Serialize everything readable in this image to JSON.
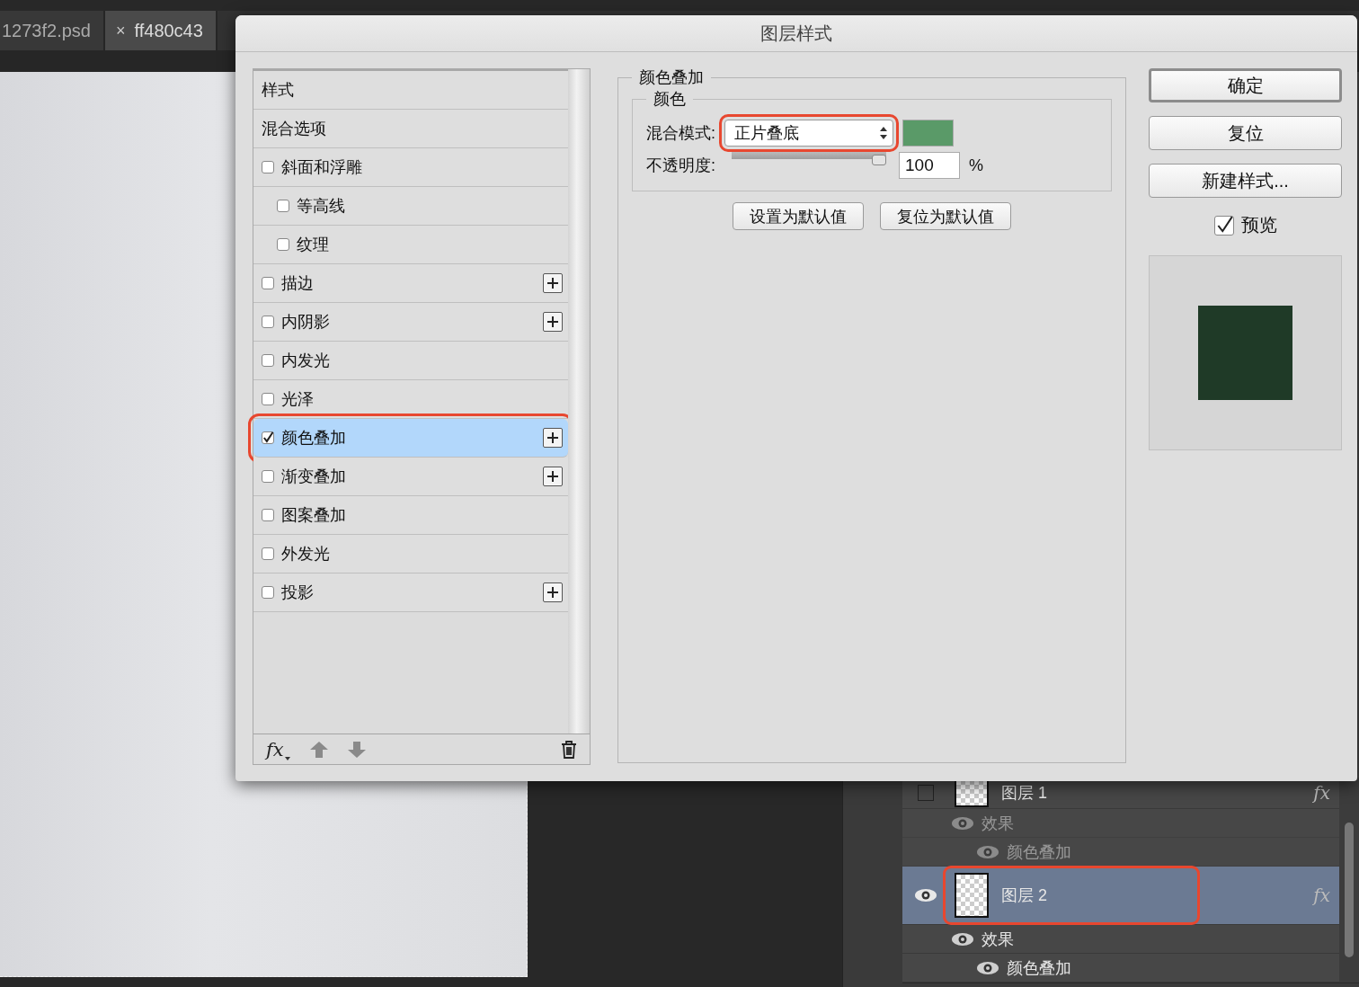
{
  "document_tabs": [
    {
      "label": "1273f2.psd",
      "selected": false
    },
    {
      "label": "ff480c43",
      "selected": true,
      "close_mark": "×"
    }
  ],
  "dialog": {
    "title": "图层样式",
    "styles": [
      {
        "kind": "header",
        "label": "样式",
        "selected": false,
        "highlighted": false
      },
      {
        "kind": "header",
        "label": "混合选项",
        "selected": false,
        "highlighted": false
      },
      {
        "kind": "check",
        "label": "斜面和浮雕",
        "checked": false,
        "selected": false,
        "addable": false,
        "highlighted": false,
        "children": [
          {
            "label": "等高线",
            "checked": false,
            "selected": false
          },
          {
            "label": "纹理",
            "checked": false,
            "selected": false
          }
        ]
      },
      {
        "kind": "check",
        "label": "描边",
        "checked": false,
        "selected": false,
        "addable": true,
        "highlighted": false
      },
      {
        "kind": "check",
        "label": "内阴影",
        "checked": false,
        "selected": false,
        "addable": true,
        "highlighted": false
      },
      {
        "kind": "check",
        "label": "内发光",
        "checked": false,
        "selected": false,
        "addable": false,
        "highlighted": false
      },
      {
        "kind": "check",
        "label": "光泽",
        "checked": false,
        "selected": false,
        "addable": false,
        "highlighted": false
      },
      {
        "kind": "check",
        "label": "颜色叠加",
        "checked": true,
        "selected": true,
        "addable": true,
        "highlighted": true
      },
      {
        "kind": "check",
        "label": "渐变叠加",
        "checked": false,
        "selected": false,
        "addable": true,
        "highlighted": false
      },
      {
        "kind": "check",
        "label": "图案叠加",
        "checked": false,
        "selected": false,
        "addable": false,
        "highlighted": false
      },
      {
        "kind": "check",
        "label": "外发光",
        "checked": false,
        "selected": false,
        "addable": false,
        "highlighted": false
      },
      {
        "kind": "check",
        "label": "投影",
        "checked": false,
        "selected": false,
        "addable": true,
        "highlighted": false
      }
    ],
    "footer": {
      "fx_label": "fx"
    },
    "overlay": {
      "title": "颜色叠加",
      "group": "颜色",
      "blend_label": "混合模式:",
      "blend_value": "正片叠底",
      "blend_highlighted": true,
      "color": "#5a9a68",
      "opacity_label": "不透明度:",
      "level": 1,
      "opacity_value": "100",
      "opacity_unit": "%",
      "buttons": [
        "设置为默认值",
        "复位为默认值"
      ]
    },
    "actions": [
      {
        "label": "确定",
        "default": true
      },
      {
        "label": "复位",
        "default": false
      },
      {
        "label": "新建样式...",
        "default": false
      }
    ],
    "preview": {
      "label": "预览",
      "checked": true,
      "color": "#1f3a27"
    }
  },
  "layers": [
    {
      "name": "图层 1",
      "visible": false,
      "selected": false,
      "highlighted": false,
      "fx": "fx",
      "effects_label": "效果",
      "effects": [
        {
          "name": "颜色叠加"
        }
      ]
    },
    {
      "name": "图层 2",
      "visible": true,
      "selected": true,
      "highlighted": true,
      "fx": "fx",
      "effects_label": "效果",
      "effects": [
        {
          "name": "颜色叠加"
        }
      ]
    }
  ]
}
